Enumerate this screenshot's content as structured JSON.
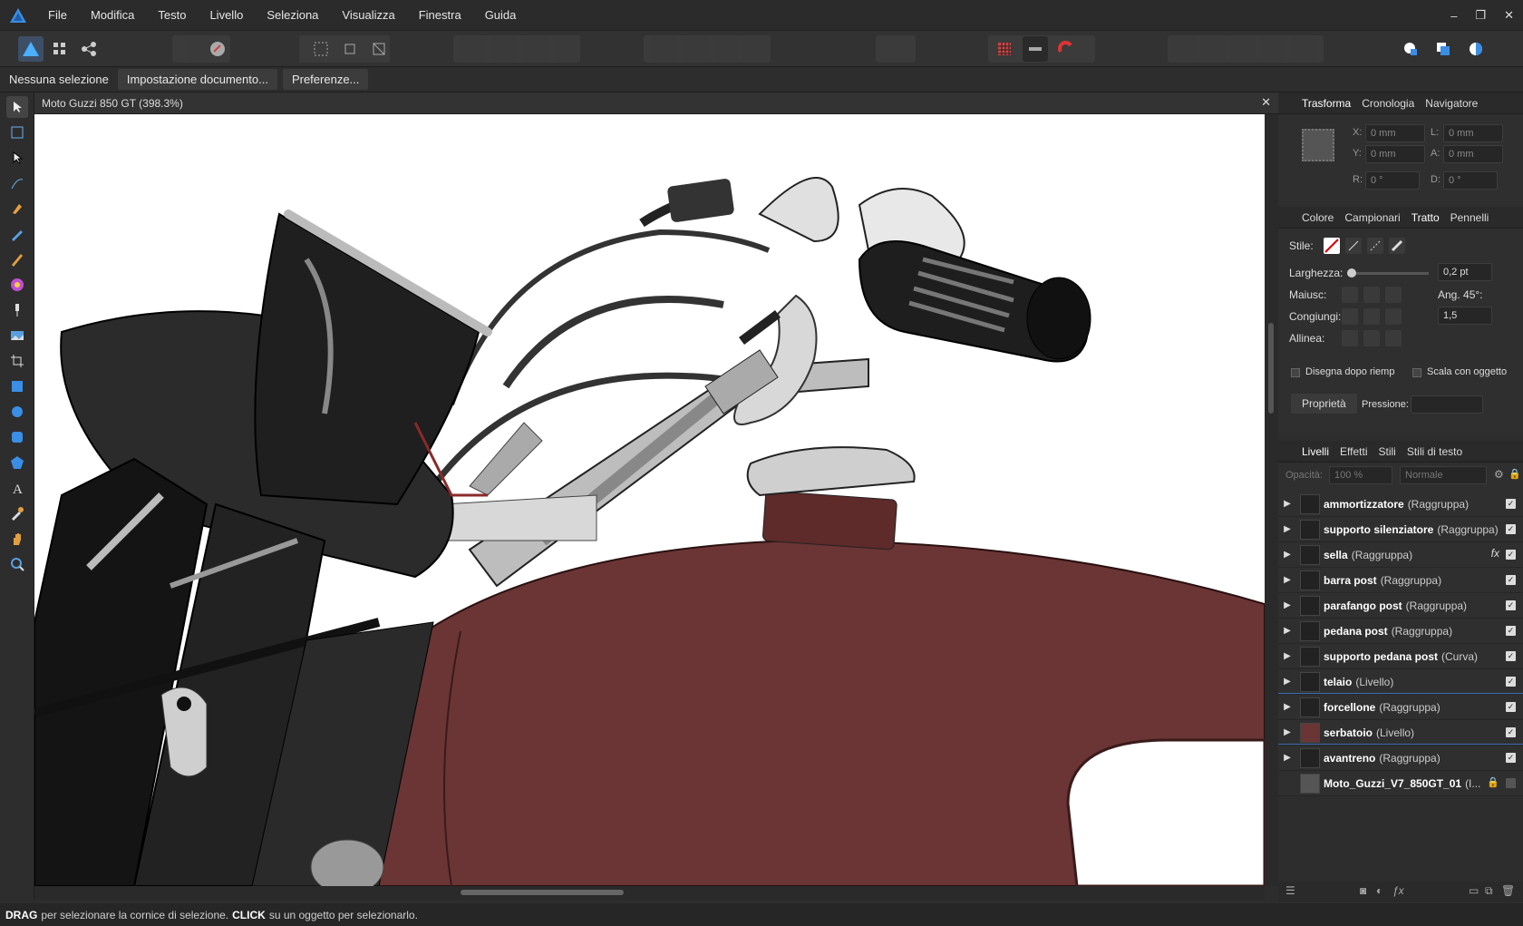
{
  "menubar": {
    "items": [
      "File",
      "Modifica",
      "Testo",
      "Livello",
      "Seleziona",
      "Visualizza",
      "Finestra",
      "Guida"
    ],
    "window_controls": [
      "–",
      "❐",
      "✕"
    ]
  },
  "context": {
    "selection_label": "Nessuna selezione",
    "doc_setup_button": "Impostazione documento...",
    "prefs_button": "Preferenze..."
  },
  "document": {
    "tab_title": "Moto Guzzi 850 GT (398.3%)",
    "close_label": "✕"
  },
  "transform_panel": {
    "tabs": [
      "Trasforma",
      "Cronologia",
      "Navigatore"
    ],
    "x_label": "X:",
    "x_value": "0 mm",
    "y_label": "Y:",
    "y_value": "0 mm",
    "w_label": "L:",
    "w_value": "0 mm",
    "h_label": "A:",
    "h_value": "0 mm",
    "r_label": "R:",
    "r_value": "0 °",
    "s_label": "D:",
    "s_value": "0 °"
  },
  "stroke_panel": {
    "tabs": [
      "Colore",
      "Campionari",
      "Tratto",
      "Pennelli"
    ],
    "style_label": "Stile:",
    "width_label": "Larghezza:",
    "width_value": "0,2 pt",
    "cap_label": "Maiusc:",
    "angle_label": "Ang. 45°:",
    "join_label": "Congiungi:",
    "join_value": "1,5",
    "align_label": "Allinea:",
    "draw_behind_label": "Disegna dopo riemp",
    "scale_with_object_label": "Scala con oggetto",
    "properties_button": "Proprietà",
    "pressure_label": "Pressione:"
  },
  "layers_panel": {
    "tabs": [
      "Livelli",
      "Effetti",
      "Stili",
      "Stili di testo"
    ],
    "opacity_label": "Opacità:",
    "opacity_value": "100 %",
    "blend_value": "Normale",
    "items": [
      {
        "name": "ammortizzatore",
        "type": "(Raggruppa)"
      },
      {
        "name": "supporto silenziatore",
        "type": "(Raggruppa)"
      },
      {
        "name": "sella",
        "type": "(Raggruppa)",
        "fx": "fx"
      },
      {
        "name": "barra post",
        "type": "(Raggruppa)"
      },
      {
        "name": "parafango post",
        "type": "(Raggruppa)"
      },
      {
        "name": "pedana post",
        "type": "(Raggruppa)"
      },
      {
        "name": "supporto pedana post",
        "type": "(Curva)"
      },
      {
        "name": "telaio",
        "type": "(Livello)"
      },
      {
        "name": "forcellone",
        "type": "(Raggruppa)"
      },
      {
        "name": "serbatoio",
        "type": "(Livello)"
      },
      {
        "name": "avantreno",
        "type": "(Raggruppa)"
      },
      {
        "name": "Moto_Guzzi_V7_850GT_01",
        "type": "(I..."
      }
    ]
  },
  "status": {
    "drag_key": "DRAG",
    "drag_text": "per selezionare la cornice di selezione.",
    "click_key": "CLICK",
    "click_text": "su un oggetto per selezionarlo."
  },
  "colors": {
    "tank": "#6b3535",
    "accent": "#3a8ee6",
    "canvas": "#ffffff"
  }
}
